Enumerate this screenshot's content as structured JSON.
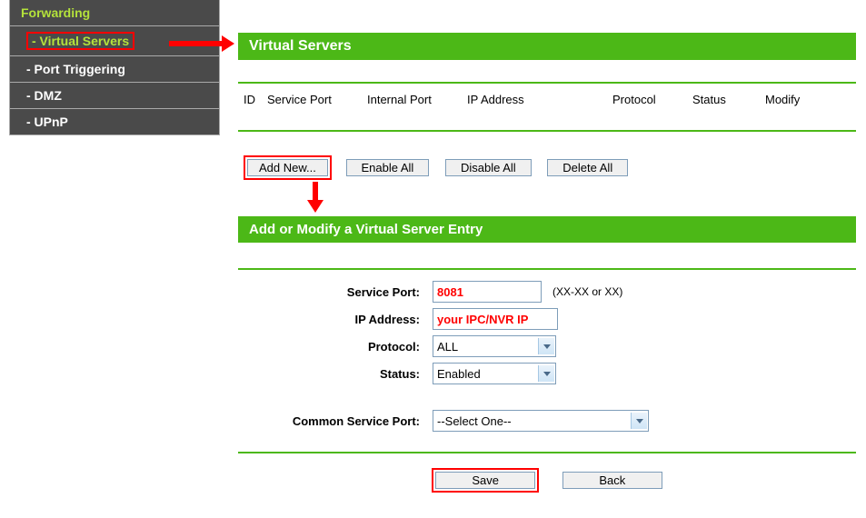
{
  "sidebar": {
    "header": "Forwarding",
    "items": [
      {
        "label": "- Virtual Servers"
      },
      {
        "label": "- Port Triggering"
      },
      {
        "label": "- DMZ"
      },
      {
        "label": "- UPnP"
      }
    ]
  },
  "vs": {
    "title": "Virtual Servers",
    "cols": {
      "id": "ID",
      "service_port": "Service Port",
      "internal_port": "Internal Port",
      "ip": "IP Address",
      "protocol": "Protocol",
      "status": "Status",
      "modify": "Modify"
    },
    "buttons": {
      "add": "Add New...",
      "enable": "Enable All",
      "disable": "Disable All",
      "delete": "Delete All"
    }
  },
  "form": {
    "title": "Add or Modify a Virtual Server Entry",
    "labels": {
      "service_port": "Service Port:",
      "ip": "IP Address:",
      "protocol": "Protocol:",
      "status": "Status:",
      "common": "Common Service Port:"
    },
    "values": {
      "service_port": "8081",
      "ip": "your IPC/NVR IP",
      "protocol": "ALL",
      "status": "Enabled",
      "common": "--Select One--"
    },
    "hint": "(XX-XX or XX)",
    "save": "Save",
    "back": "Back"
  }
}
